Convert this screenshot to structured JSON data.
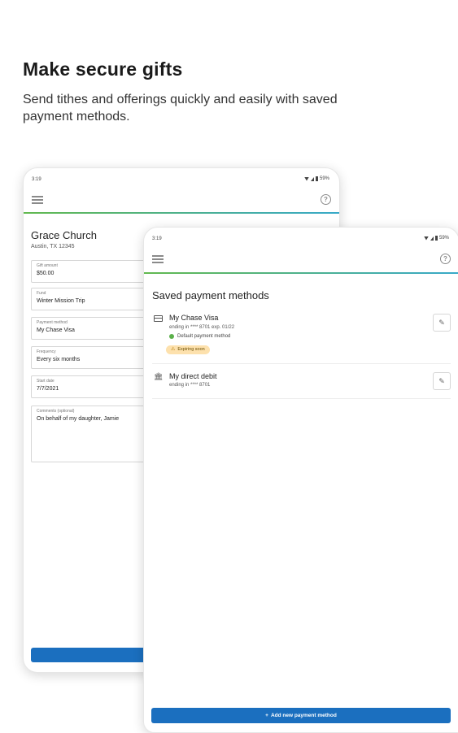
{
  "hero": {
    "title": "Make secure gifts",
    "subtitle": "Send tithes and offerings quickly and easily with saved payment methods."
  },
  "back_screen": {
    "status_time": "3:19",
    "status_battery": "59%",
    "church_name": "Grace Church",
    "church_location": "Austin, TX 12345",
    "fields": [
      {
        "label": "Gift amount",
        "value": "$50.00"
      },
      {
        "label": "Fund",
        "value": "Winter Mission Trip"
      },
      {
        "label": "Payment method",
        "value": "My Chase Visa"
      },
      {
        "label": "Frequency",
        "value": "Every six months"
      },
      {
        "label": "Start date",
        "value": "7/7/2021"
      },
      {
        "label": "Comments (optional)",
        "value": "On behalf of my daughter, Jamie"
      }
    ]
  },
  "front_screen": {
    "status_time": "3:19",
    "status_battery": "59%",
    "title": "Saved payment methods",
    "methods": [
      {
        "name": "My Chase Visa",
        "detail": "ending in **** 8701 exp. 01/22",
        "default_label": "Default payment method",
        "badge": "Expiring soon",
        "icon": "credit-card-icon"
      },
      {
        "name": "My direct debit",
        "detail": "ending in **** 8701",
        "icon": "bank-icon"
      }
    ],
    "add_button_icon": "+",
    "add_button_label": "Add new payment method"
  },
  "colors": {
    "primary": "#1b6fbf",
    "accent_start": "#62b94f",
    "accent_end": "#38a9c9",
    "default_dot": "#5bb04a",
    "badge_bg": "#fde1ad"
  }
}
